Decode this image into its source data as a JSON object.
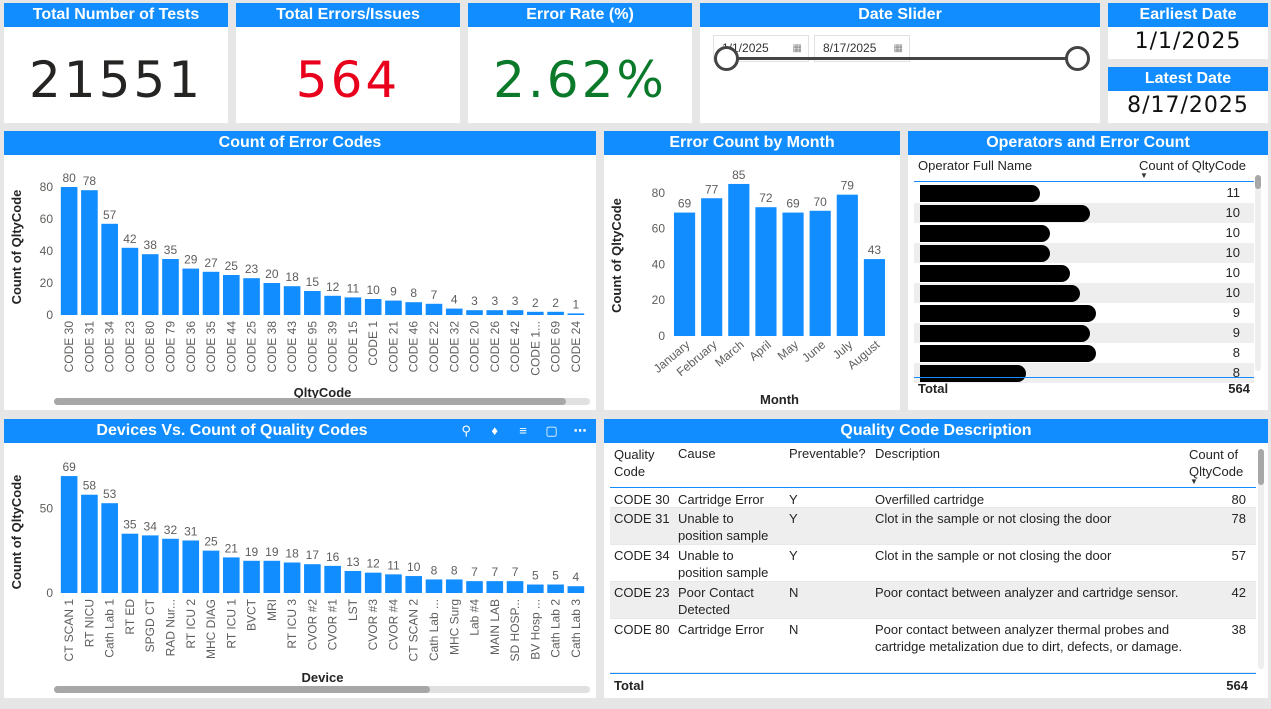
{
  "kpis": {
    "total_tests": {
      "title": "Total Number of Tests",
      "value": "21551",
      "color": "#252423"
    },
    "total_errors": {
      "title": "Total Errors/Issues",
      "value": "564",
      "color": "#e8001c"
    },
    "error_rate": {
      "title": "Error Rate (%)",
      "value": "2.62%",
      "color": "#0a7a2a"
    }
  },
  "date_slider": {
    "title": "Date Slider",
    "start": "1/1/2025",
    "end": "8/17/2025",
    "calendar_icon": "calendar-icon"
  },
  "earliest_date": {
    "title": "Earliest Date",
    "value": "1/1/2025"
  },
  "latest_date": {
    "title": "Latest Date",
    "value": "8/17/2025"
  },
  "error_codes_chart": {
    "title": "Count of Error Codes",
    "chart_data": {
      "type": "bar",
      "xlabel": "QltyCode",
      "ylabel": "Count of QltyCode",
      "ylim": [
        0,
        85
      ],
      "yticks": [
        0,
        20,
        40,
        60,
        80
      ],
      "categories": [
        "CODE 30",
        "CODE 31",
        "CODE 34",
        "CODE 23",
        "CODE 80",
        "CODE 79",
        "CODE 36",
        "CODE 35",
        "CODE 44",
        "CODE 25",
        "CODE 38",
        "CODE 43",
        "CODE 95",
        "CODE 39",
        "CODE 15",
        "CODE 1",
        "CODE 21",
        "CODE 46",
        "CODE 22",
        "CODE 32",
        "CODE 20",
        "CODE 26",
        "CODE 42",
        "CODE 1...",
        "CODE 69",
        "CODE 24"
      ],
      "values": [
        80,
        78,
        57,
        42,
        38,
        35,
        29,
        27,
        25,
        23,
        20,
        18,
        15,
        12,
        11,
        10,
        9,
        8,
        7,
        4,
        3,
        3,
        3,
        2,
        2,
        1
      ],
      "color": "#118dff"
    }
  },
  "month_chart": {
    "title": "Error Count by Month",
    "chart_data": {
      "type": "bar",
      "xlabel": "Month",
      "ylabel": "Count of QltyCode",
      "ylim": [
        0,
        90
      ],
      "yticks": [
        0,
        20,
        40,
        60,
        80
      ],
      "categories": [
        "January",
        "February",
        "March",
        "April",
        "May",
        "June",
        "July",
        "August"
      ],
      "values": [
        69,
        77,
        85,
        72,
        69,
        70,
        79,
        43
      ],
      "color": "#118dff"
    }
  },
  "operators": {
    "title": "Operators and Error Count",
    "col_name": "Operator Full Name",
    "col_count": "Count of QltyCode",
    "counts": [
      "11",
      "10",
      "10",
      "10",
      "10",
      "10",
      "9",
      "9",
      "8",
      "8"
    ],
    "total_label": "Total",
    "total_value": "564"
  },
  "devices_chart": {
    "title": "Devices Vs. Count of Quality Codes",
    "chart_data": {
      "type": "bar",
      "xlabel": "Device",
      "ylabel": "Count of QltyCode",
      "ylim": [
        0,
        72
      ],
      "yticks": [
        0,
        50
      ],
      "categories": [
        "CT SCAN 1",
        "RT NICU",
        "Cath Lab 1",
        "RT ED",
        "SPGD CT",
        "RAD Nur...",
        "RT ICU 2",
        "MHC DIAG",
        "RT ICU 1",
        "BVCT",
        "MRI",
        "RT ICU 3",
        "CVOR #2",
        "CVOR #1",
        "LST",
        "CVOR #3",
        "CVOR #4",
        "CT SCAN 2",
        "Cath Lab ...",
        "MHC Surg",
        "Lab #4",
        "MAIN LAB",
        "SD HOSP...",
        "BV Hosp ...",
        "Cath Lab 2",
        "Cath Lab 3"
      ],
      "values": [
        69,
        58,
        53,
        35,
        34,
        32,
        31,
        25,
        21,
        19,
        19,
        18,
        17,
        16,
        13,
        12,
        11,
        10,
        8,
        8,
        7,
        7,
        7,
        5,
        5,
        4
      ],
      "color": "#118dff"
    }
  },
  "quality_table": {
    "title": "Quality Code Description",
    "headers": {
      "code": "Quality Code",
      "cause": "Cause",
      "prev": "Preventable?",
      "desc": "Description",
      "count": "Count of QltyCode"
    },
    "rows": [
      {
        "code": "CODE 30",
        "cause": "Cartridge Error",
        "prev": "Y",
        "desc": "Overfilled cartridge",
        "count": "80"
      },
      {
        "code": "CODE 31",
        "cause": "Unable to position sample",
        "prev": "Y",
        "desc": "Clot in the sample or not closing the door",
        "count": "78"
      },
      {
        "code": "CODE 34",
        "cause": "Unable to position sample",
        "prev": "Y",
        "desc": "Clot in the sample or not closing the door",
        "count": "57"
      },
      {
        "code": "CODE 23",
        "cause": "Poor Contact Detected",
        "prev": "N",
        "desc": "Poor contact between analyzer and cartridge sensor.",
        "count": "42"
      },
      {
        "code": "CODE 80",
        "cause": "Cartridge Error",
        "prev": "N",
        "desc": "Poor contact between analyzer thermal probes and cartridge metalization due to dirt, defects, or damage.",
        "count": "38"
      }
    ],
    "total_label": "Total",
    "total_value": "564"
  },
  "visual_header_icons": [
    "pin-icon",
    "bell-icon",
    "filter-icon",
    "focus-mode-icon",
    "more-options-icon"
  ]
}
